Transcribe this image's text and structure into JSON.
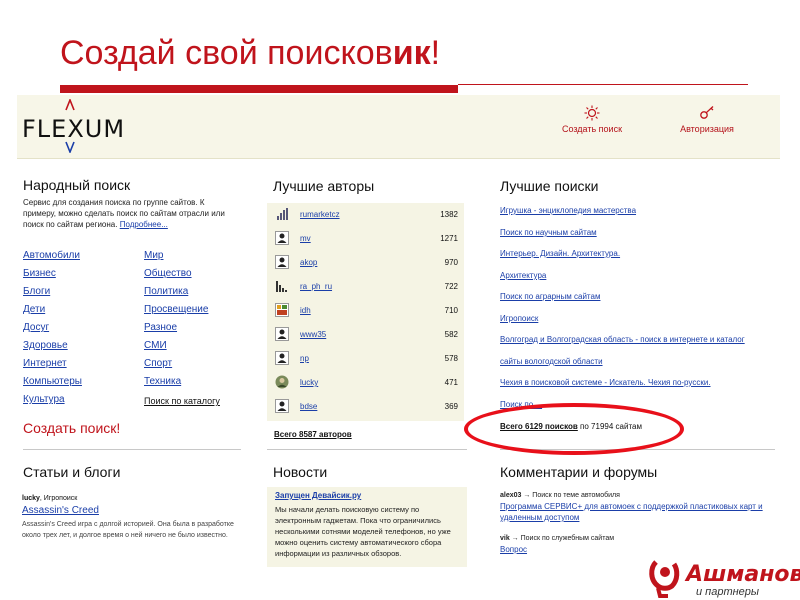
{
  "slide": {
    "title_main": "Создай свой поисков",
    "title_bold": "ик",
    "title_end": "!"
  },
  "site": {
    "logo_text": "FLEXUM",
    "header_actions": [
      {
        "label": "Создать поиск",
        "icon": "sun-icon"
      },
      {
        "label": "Авторизация",
        "icon": "key-icon"
      }
    ]
  },
  "people_search": {
    "title": "Народный поиск",
    "description": "Сервис для создания поиска по группе сайтов. К примеру, можно сделать поиск по сайтам отрасли или поиск по сайтам региона.",
    "more_link": "Подробнее...",
    "categories_left": [
      "Автомобили",
      "Бизнес",
      "Блоги",
      "Дети",
      "Досуг",
      "Здоровье",
      "Интернет",
      "Компьютеры",
      "Культура"
    ],
    "categories_right": [
      "Мир",
      "Общество",
      "Политика",
      "Просвещение",
      "Разное",
      "СМИ",
      "Спорт",
      "Техника"
    ],
    "catalog_search": "Поиск по каталогу",
    "create_search": "Создать поиск!"
  },
  "best_authors": {
    "title": "Лучшие авторы",
    "authors": [
      {
        "name": "rumarketcz",
        "count": "1382",
        "icon": "chart-icon"
      },
      {
        "name": "mv",
        "count": "1271",
        "icon": "user-icon"
      },
      {
        "name": "akop",
        "count": "970",
        "icon": "user-icon"
      },
      {
        "name": "ra_ph_ru",
        "count": "722",
        "icon": "chart-icon"
      },
      {
        "name": "idh",
        "count": "710",
        "icon": "photo-icon"
      },
      {
        "name": "www35",
        "count": "582",
        "icon": "user-icon"
      },
      {
        "name": "np",
        "count": "578",
        "icon": "user-icon"
      },
      {
        "name": "lucky",
        "count": "471",
        "icon": "avatar-icon"
      },
      {
        "name": "bdse",
        "count": "369",
        "icon": "user-icon"
      }
    ],
    "total": "Всего 8587 авторов"
  },
  "best_searches": {
    "title": "Лучшие поиски",
    "links": [
      "Игрушка - энциклопедия мастерства",
      "Поиск по научным сайтам",
      "Интерьер. Дизайн. Архитектура.",
      "Архитектура",
      "Поиск по аграрным сайтам",
      "Игропоиск",
      "Волгоград и Волгоградская область - поиск в интернете и каталог",
      "сайты вологодской области",
      "Чехия в поисковой системе - Искатель. Чехия по-русски.",
      "Поиск по ..."
    ],
    "total_bold": "Всего 6129 поисков",
    "total_rest": " по 71994 сайтам"
  },
  "articles": {
    "title": "Статьи и блоги",
    "author": "lucky",
    "author_suffix": ", Игропоиск",
    "link": "Assassin's Creed",
    "text": "Assassin's Creed игра с долгой историей. Она была в разработке около трех лет, и долгое время о ней ничего не было известно."
  },
  "news": {
    "title": "Новости",
    "headline": "Запущен Девайсик.ру",
    "text": "Мы начали делать поисковую систему по электронным гаджетам. Пока что ограничились несколькими сотнями моделей телефонов, но уже можно оценить систему автоматического сбора информации из различных обзоров."
  },
  "comments": {
    "title": "Комментарии и форумы",
    "items": [
      {
        "user": "alex03",
        "context": " → Поиск по теме автомобиля",
        "link": "Программа СЕРВИС+ для автомоек с поддержкой пластиковых карт и удаленным доступом"
      },
      {
        "user": "vik",
        "context": " → Поиск по служебным сайтам",
        "link": "Вопрос"
      }
    ]
  },
  "brand": {
    "name": "Ашманов",
    "sub": "и партнеры",
    "mark": "®"
  },
  "colors": {
    "accent_red": "#c0141c",
    "link_blue": "#1a3ea8",
    "panel_bg": "#f5f4e4",
    "oval_red": "#e8101a"
  }
}
